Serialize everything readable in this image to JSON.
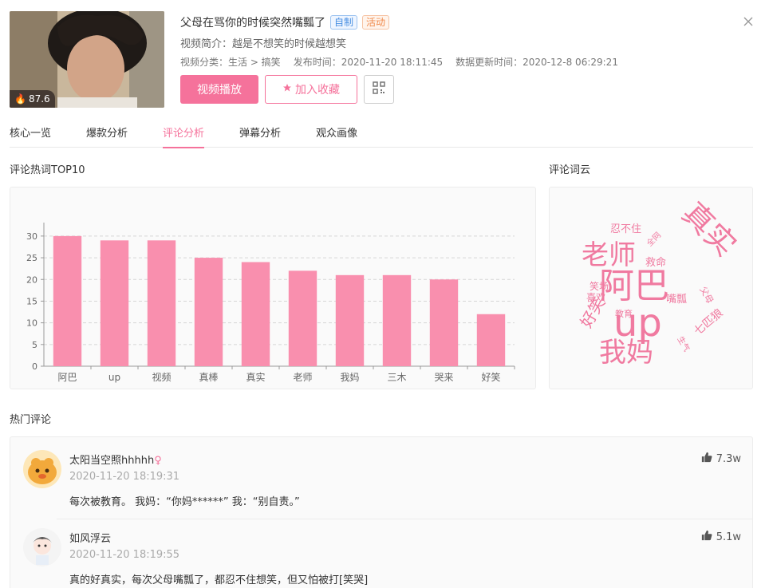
{
  "video": {
    "title": "父母在骂你的时候突然嘴瓢了",
    "tags": [
      "自制",
      "活动"
    ],
    "intro": "视频简介：越是不想笑的时候越想笑",
    "category": "视频分类：生活 > 搞笑",
    "publish_time": "发布时间：2020-11-20 18:11:45",
    "update_time": "数据更新时间：2020-12-8 06:29:21",
    "heat": "87.6"
  },
  "actions": {
    "play": "视频播放",
    "favorite": "加入收藏"
  },
  "tabs": [
    "核心一览",
    "爆款分析",
    "评论分析",
    "弹幕分析",
    "观众画像"
  ],
  "active_tab": "评论分析",
  "sections": {
    "hotwords": "评论热词TOP10",
    "wordcloud": "评论词云",
    "hot_comments": "热门评论"
  },
  "chart_data": {
    "type": "bar",
    "categories": [
      "阿巴",
      "up",
      "视频",
      "真棒",
      "真实",
      "老师",
      "我妈",
      "三木",
      "哭来",
      "好笑"
    ],
    "values": [
      30,
      29,
      29,
      25,
      24,
      22,
      21,
      21,
      20,
      12
    ],
    "yticks": [
      0,
      5,
      10,
      15,
      20,
      25,
      30
    ],
    "ylim": [
      0,
      32
    ],
    "color": "#f98fae",
    "grid": true
  },
  "wordcloud": {
    "words": [
      "阿巴",
      "up",
      "真实",
      "老师",
      "我妈",
      "好笑",
      "忍不住",
      "救命",
      "笑场",
      "喜欢",
      "教育",
      "嘴瓢",
      "七匹狼",
      "父母",
      "生气",
      "全网"
    ]
  },
  "comments": [
    {
      "user": "太阳当空照hhhhh",
      "gender": "♀",
      "time": "2020-11-20 18:19:31",
      "text": "每次被教育。 我妈：“你妈******” 我：“别自责。”",
      "likes": "7.3w"
    },
    {
      "user": "如风浮云",
      "time": "2020-11-20 18:19:55",
      "text": "真的好真实，每次父母嘴瓢了，都忍不住想笑，但又怕被打[笑哭]",
      "likes": "5.1w"
    }
  ],
  "colors": {
    "accent": "#f5729b",
    "bar": "#f98fae",
    "wordcloud": "#f07aa0"
  }
}
